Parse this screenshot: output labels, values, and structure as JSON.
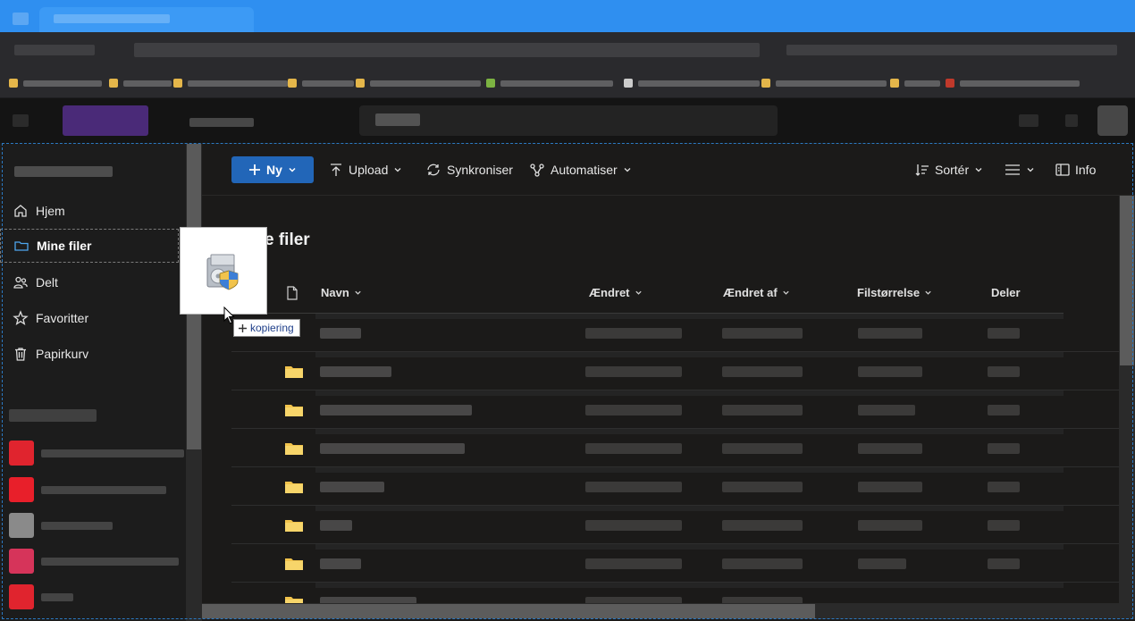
{
  "colors": {
    "accent": "#2266b8",
    "folder": "#f1c34c",
    "active_icon": "#4ea6ee"
  },
  "nav": {
    "items": [
      {
        "label": "Hjem",
        "icon": "home-icon"
      },
      {
        "label": "Mine filer",
        "icon": "folder-icon",
        "active": true
      },
      {
        "label": "Delt",
        "icon": "people-icon"
      },
      {
        "label": "Favoritter",
        "icon": "star-icon"
      },
      {
        "label": "Papirkurv",
        "icon": "trash-icon"
      }
    ]
  },
  "toolbar": {
    "new_label": "Ny",
    "upload_label": "Upload",
    "sync_label": "Synkroniser",
    "automate_label": "Automatiser",
    "sort_label": "Sortér",
    "info_label": "Info"
  },
  "page": {
    "title": "e filer"
  },
  "columns": [
    "Navn",
    "Ændret",
    "Ændret af",
    "Filstørrelse",
    "Deler"
  ],
  "drag": {
    "tooltip": "kopiering"
  }
}
